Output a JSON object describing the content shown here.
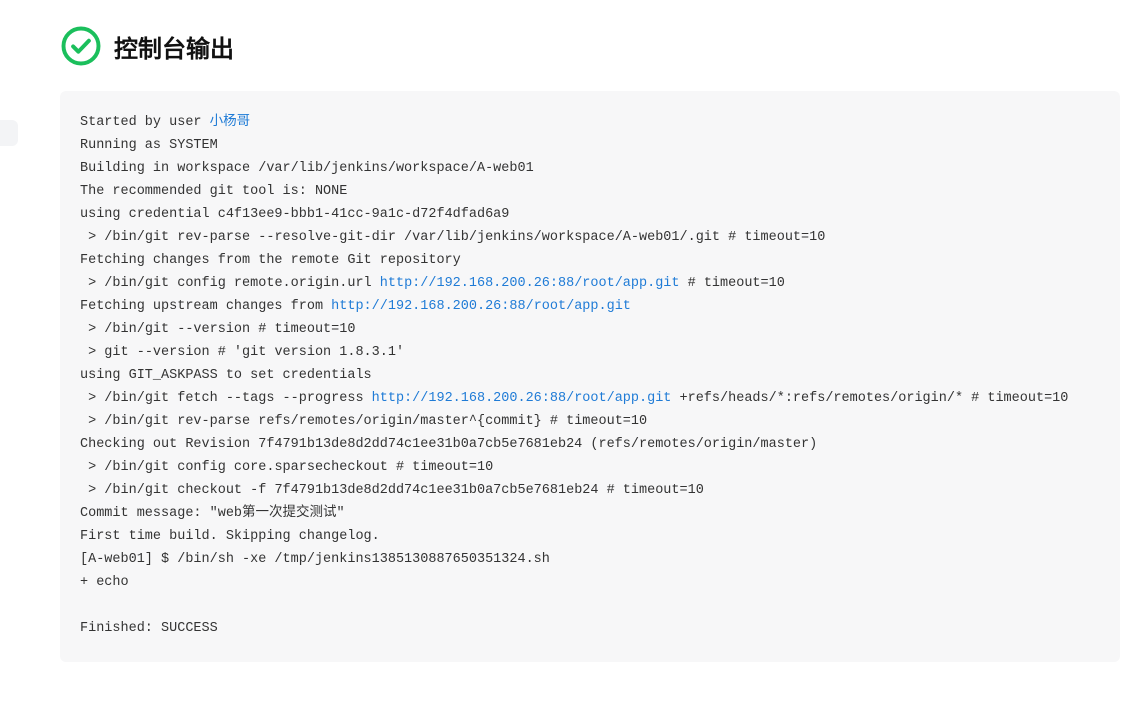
{
  "header": {
    "title": "控制台输出"
  },
  "console": {
    "lines": [
      {
        "parts": [
          {
            "t": "text",
            "v": "Started by user "
          },
          {
            "t": "link",
            "v": "小杨哥"
          }
        ]
      },
      {
        "parts": [
          {
            "t": "text",
            "v": "Running as SYSTEM"
          }
        ]
      },
      {
        "parts": [
          {
            "t": "text",
            "v": "Building in workspace /var/lib/jenkins/workspace/A-web01"
          }
        ]
      },
      {
        "parts": [
          {
            "t": "text",
            "v": "The recommended git tool is: NONE"
          }
        ]
      },
      {
        "parts": [
          {
            "t": "text",
            "v": "using credential c4f13ee9-bbb1-41cc-9a1c-d72f4dfad6a9"
          }
        ]
      },
      {
        "parts": [
          {
            "t": "text",
            "v": " > /bin/git rev-parse --resolve-git-dir /var/lib/jenkins/workspace/A-web01/.git # timeout=10"
          }
        ]
      },
      {
        "parts": [
          {
            "t": "text",
            "v": "Fetching changes from the remote Git repository"
          }
        ]
      },
      {
        "parts": [
          {
            "t": "text",
            "v": " > /bin/git config remote.origin.url "
          },
          {
            "t": "link",
            "v": "http://192.168.200.26:88/root/app.git"
          },
          {
            "t": "text",
            "v": " # timeout=10"
          }
        ]
      },
      {
        "parts": [
          {
            "t": "text",
            "v": "Fetching upstream changes from "
          },
          {
            "t": "link",
            "v": "http://192.168.200.26:88/root/app.git"
          }
        ]
      },
      {
        "parts": [
          {
            "t": "text",
            "v": " > /bin/git --version # timeout=10"
          }
        ]
      },
      {
        "parts": [
          {
            "t": "text",
            "v": " > git --version # 'git version 1.8.3.1'"
          }
        ]
      },
      {
        "parts": [
          {
            "t": "text",
            "v": "using GIT_ASKPASS to set credentials "
          }
        ]
      },
      {
        "parts": [
          {
            "t": "text",
            "v": " > /bin/git fetch --tags --progress "
          },
          {
            "t": "link",
            "v": "http://192.168.200.26:88/root/app.git"
          },
          {
            "t": "text",
            "v": " +refs/heads/*:refs/remotes/origin/* # timeout=10"
          }
        ]
      },
      {
        "parts": [
          {
            "t": "text",
            "v": " > /bin/git rev-parse refs/remotes/origin/master^{commit} # timeout=10"
          }
        ]
      },
      {
        "parts": [
          {
            "t": "text",
            "v": "Checking out Revision 7f4791b13de8d2dd74c1ee31b0a7cb5e7681eb24 (refs/remotes/origin/master)"
          }
        ]
      },
      {
        "parts": [
          {
            "t": "text",
            "v": " > /bin/git config core.sparsecheckout # timeout=10"
          }
        ]
      },
      {
        "parts": [
          {
            "t": "text",
            "v": " > /bin/git checkout -f 7f4791b13de8d2dd74c1ee31b0a7cb5e7681eb24 # timeout=10"
          }
        ]
      },
      {
        "parts": [
          {
            "t": "text",
            "v": "Commit message: \"web第一次提交测试\""
          }
        ]
      },
      {
        "parts": [
          {
            "t": "text",
            "v": "First time build. Skipping changelog."
          }
        ]
      },
      {
        "parts": [
          {
            "t": "text",
            "v": "[A-web01] $ /bin/sh -xe /tmp/jenkins1385130887650351324.sh"
          }
        ]
      },
      {
        "parts": [
          {
            "t": "text",
            "v": "+ echo"
          }
        ]
      },
      {
        "parts": []
      },
      {
        "parts": [
          {
            "t": "text",
            "v": "Finished: SUCCESS"
          }
        ]
      }
    ]
  },
  "colors": {
    "success": "#1bbf5c",
    "link": "#1f7bd6"
  }
}
